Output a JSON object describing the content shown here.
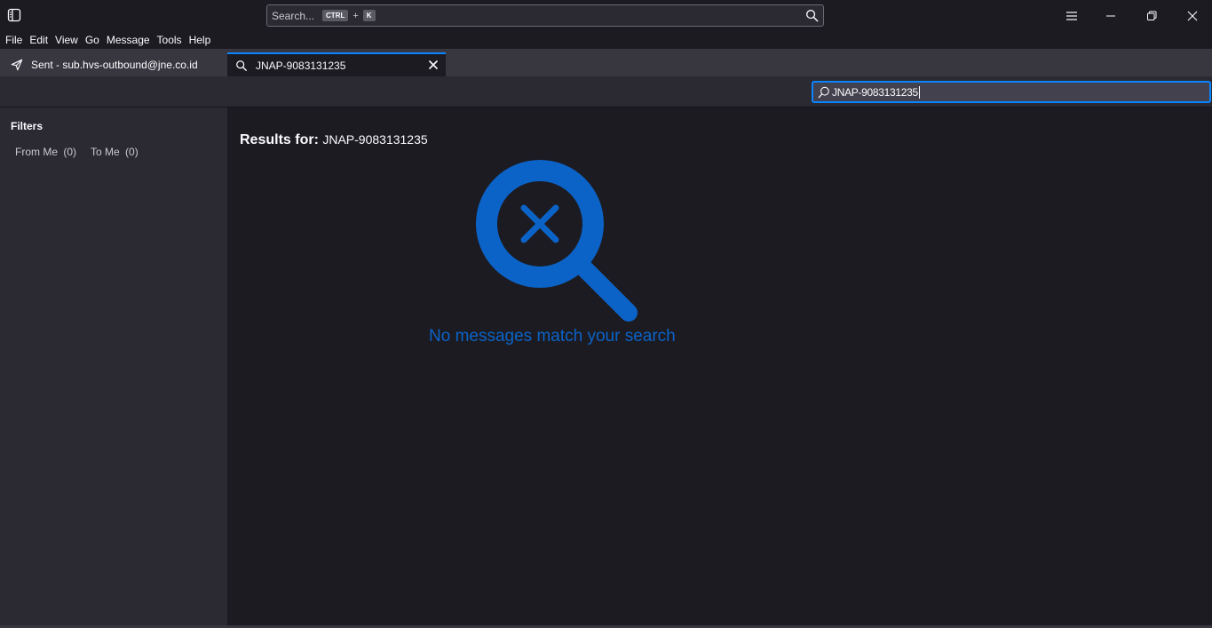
{
  "titlebar": {
    "search_placeholder": "Search...",
    "shortcut_ctrl": "CTRL",
    "shortcut_plus": "+",
    "shortcut_k": "K",
    "icons": [
      "sidebar-toggle-icon",
      "search-icon",
      "hamburger-menu-icon",
      "minimize-icon",
      "restore-icon",
      "close-icon"
    ]
  },
  "menu": {
    "items": [
      "File",
      "Edit",
      "View",
      "Go",
      "Message",
      "Tools",
      "Help"
    ]
  },
  "tabs": [
    {
      "label": "Sent - sub.hvs-outbound@jne.co.id",
      "icon": "paper-plane-icon",
      "active": false
    },
    {
      "label": "JNAP-9083131235",
      "icon": "search-icon",
      "active": true
    }
  ],
  "toolbar": {
    "search_value": "JNAP-9083131235"
  },
  "sidebar": {
    "title": "Filters",
    "filters": [
      {
        "label": "From Me",
        "count": "(0)"
      },
      {
        "label": "To Me",
        "count": "(0)"
      }
    ]
  },
  "results": {
    "prefix": "Results for:",
    "query": "JNAP-9083131235",
    "empty_message": "No messages match your search"
  },
  "colors": {
    "accent": "#0a84ff",
    "empty_icon": "#0b63c7",
    "background": "#1c1b22",
    "panel": "#2b2a33"
  }
}
